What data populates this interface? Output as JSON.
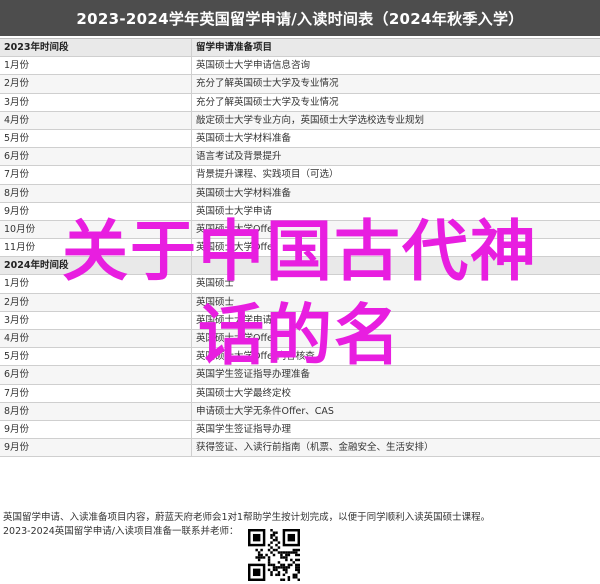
{
  "title": "2023-2024学年英国留学申请/入读时间表（2024年秋季入学）",
  "rows": [
    {
      "type": "header",
      "period": "2023年时间段",
      "item": "留学申请准备项目"
    },
    {
      "type": "row",
      "period": "1月份",
      "item": "英国硕士大学申请信息咨询"
    },
    {
      "type": "row",
      "period": "2月份",
      "item": "充分了解英国硕士大学及专业情况"
    },
    {
      "type": "row",
      "period": "3月份",
      "item": "充分了解英国硕士大学及专业情况"
    },
    {
      "type": "row",
      "period": "4月份",
      "item": "敲定硕士大学专业方向，英国硕士大学选校选专业规划"
    },
    {
      "type": "row",
      "period": "5月份",
      "item": "英国硕士大学材料准备"
    },
    {
      "type": "row",
      "period": "6月份",
      "item": "语言考试及背景提升"
    },
    {
      "type": "row",
      "period": "7月份",
      "item": "背景提升课程、实践项目（可选）"
    },
    {
      "type": "row",
      "period": "8月份",
      "item": "英国硕士大学材料准备"
    },
    {
      "type": "row",
      "period": "9月份",
      "item": "英国硕士大学申请"
    },
    {
      "type": "row",
      "period": "10月份",
      "item": "英国硕士大学Offer"
    },
    {
      "type": "row",
      "period": "11月份",
      "item": "英国硕士大学Offer"
    },
    {
      "type": "header",
      "period": "2024年时间段",
      "item": ""
    },
    {
      "type": "row",
      "period": "1月份",
      "item": "英国硕士"
    },
    {
      "type": "row",
      "period": "2月份",
      "item": "英国硕士"
    },
    {
      "type": "row",
      "period": "3月份",
      "item": "英国硕士大学申请"
    },
    {
      "type": "row",
      "period": "4月份",
      "item": "英国硕士大学Offer"
    },
    {
      "type": "row",
      "period": "5月份",
      "item": "英国硕士大学Offer内容核查"
    },
    {
      "type": "row",
      "period": "6月份",
      "item": "英国学生签证指导办理准备"
    },
    {
      "type": "row",
      "period": "7月份",
      "item": "英国硕士大学最终定校"
    },
    {
      "type": "row",
      "period": "8月份",
      "item": "申请硕士大学无条件Offer、CAS"
    },
    {
      "type": "row",
      "period": "9月份",
      "item": "英国学生签证指导办理"
    },
    {
      "type": "row",
      "period": "9月份",
      "item": "获得签证、入读行前指南（机票、金融安全、生活安排）"
    }
  ],
  "footer": {
    "line1": "英国留学申请、入读准备项目内容，蔚蓝天府老师会1对1帮助学生按计划完成，以便于同学顺利入读英国硕士课程。",
    "line2": "2023-2024英国留学申请/入读项目准备一联系并老师："
  },
  "overlay": {
    "line1": "关于中国古代神",
    "line2": "话的名"
  },
  "colors": {
    "title_bg": "#4d4d4d",
    "header_bg": "#e9e9e9",
    "overlay": "#e81ee0"
  }
}
